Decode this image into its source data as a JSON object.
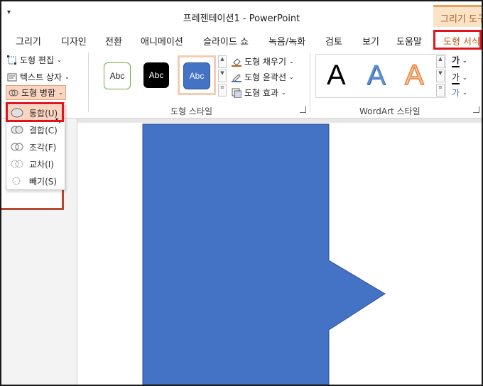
{
  "title_bar": {
    "qa_icon": "chevron-down-icon",
    "title": "프레젠테이션1  -  PowerPoint",
    "context_tab_group": "그리기 도구"
  },
  "tabs": [
    {
      "label": "그리기"
    },
    {
      "label": "디자인"
    },
    {
      "label": "전환"
    },
    {
      "label": "애니메이션"
    },
    {
      "label": "슬라이드 쇼"
    },
    {
      "label": "녹음/녹화"
    },
    {
      "label": "검토"
    },
    {
      "label": "보기"
    },
    {
      "label": "도움말"
    },
    {
      "label": "도형 서식",
      "active": true
    }
  ],
  "ribbon": {
    "insert_shapes": {
      "edit_shape": "도형 편집",
      "text_box": "텍스트 상자",
      "merge_shapes": "도형 병합"
    },
    "shape_styles": {
      "label": "도형 스타일",
      "samples": [
        "Abc",
        "Abc",
        "Abc"
      ],
      "fill": "도형 채우기",
      "outline": "도형 윤곽선",
      "effects": "도형 효과"
    },
    "wordart": {
      "label": "WordArt 스타일",
      "letters": [
        "A",
        "A",
        "A"
      ],
      "side_glyphs": [
        "가",
        "가",
        "가"
      ]
    }
  },
  "merge_menu": {
    "items": [
      {
        "label": "통합(U)",
        "icon": "union-icon",
        "highlighted": true
      },
      {
        "label": "결합(C)",
        "icon": "combine-icon"
      },
      {
        "label": "조각(F)",
        "icon": "fragment-icon"
      },
      {
        "label": "교차(I)",
        "icon": "intersect-icon"
      },
      {
        "label": "빼기(S)",
        "icon": "subtract-icon"
      }
    ]
  },
  "colors": {
    "shape_fill": "#4472c4",
    "accent_orange": "#c55a11",
    "highlight_red": "#e0141c"
  }
}
